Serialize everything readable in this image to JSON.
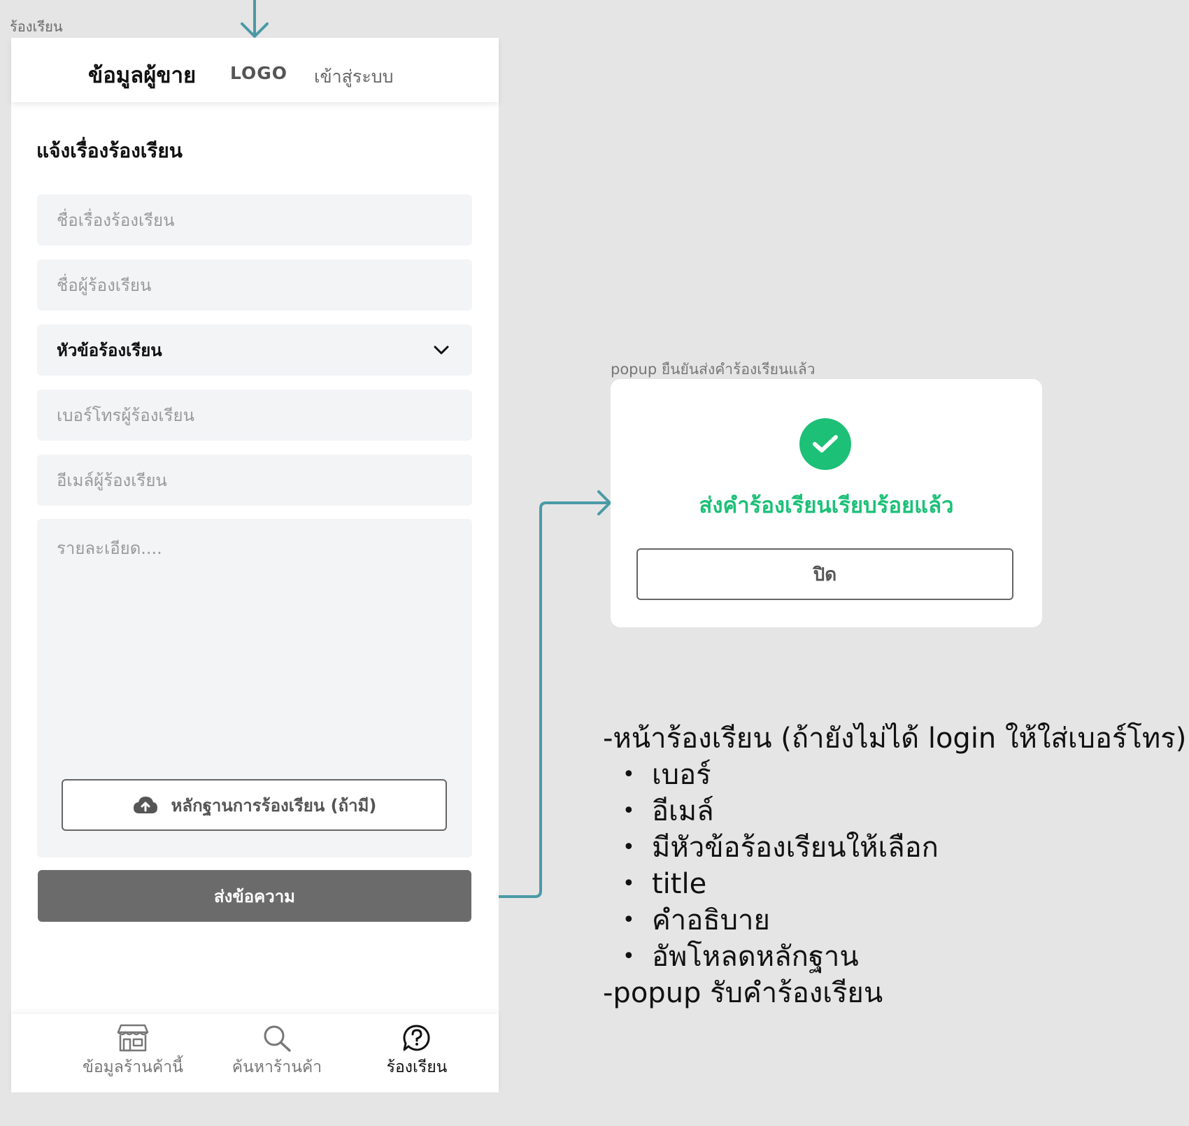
{
  "frame_label": "ร้องเรียน",
  "header": {
    "seller_tab": "ข้อมูลผู้ขาย",
    "logo": "LOGO",
    "login": "เข้าสู่ระบบ"
  },
  "form": {
    "title": "แจ้งเรื่องร้องเรียน",
    "complaint_title_placeholder": "ชื่อเรื่องร้องเรียน",
    "complainant_name_placeholder": "ชื่อผู้ร้องเรียน",
    "topic_select_value": "หัวข้อร้องเรียน",
    "phone_placeholder": "เบอร์โทรผู้ร้องเรียน",
    "email_placeholder": "อีเมล์ผู้ร้องเรียน",
    "details_placeholder": "รายละเอียด....",
    "upload_label": "หลักฐานการร้องเรียน (ถ้ามี)",
    "submit_label": "ส่งข้อความ"
  },
  "bottom_nav": {
    "items": [
      {
        "label": "ข้อมูลร้านค้านี้",
        "icon": "store-icon"
      },
      {
        "label": "ค้นหาร้านค้า",
        "icon": "search-icon"
      },
      {
        "label": "ร้องเรียน",
        "icon": "help-bubble-icon"
      }
    ],
    "active_index": 2
  },
  "popup": {
    "label": "popup ยืนยันส่งคำร้องเรียนแล้ว",
    "message": "ส่งคำร้องเรียนเรียบร้อยแล้ว",
    "close_label": "ปิด",
    "icon": "check-circle-icon",
    "accent_color": "#1cc077"
  },
  "notes": {
    "heading": "-หน้าร้องเรียน (ถ้ายังไม่ได้ login ให้ใส่เบอร์โทร)",
    "items": [
      "เบอร์",
      "อีเมล์",
      "มีหัวข้อร้องเรียนให้เลือก",
      "title",
      "คำอธิบาย",
      "อัพโหลดหลักฐาน"
    ],
    "footer": "-popup รับคำร้องเรียน"
  },
  "colors": {
    "arrow": "#4a9aa6",
    "submit_bg": "#6b6b6b",
    "field_bg": "#f3f4f6"
  }
}
